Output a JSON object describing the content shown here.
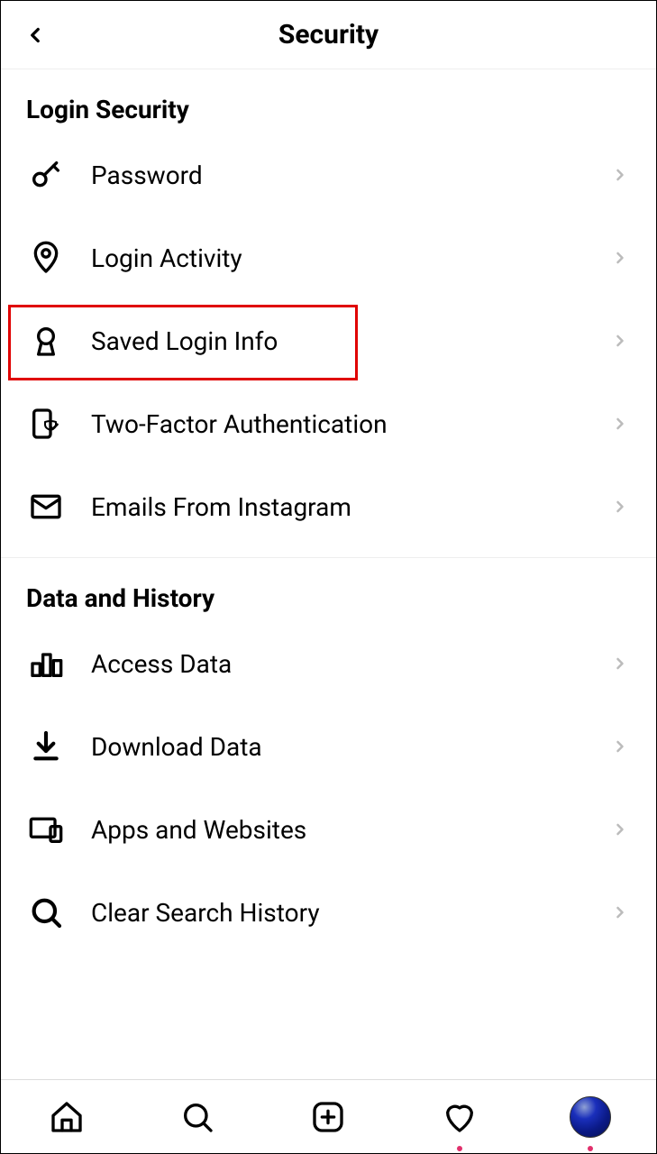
{
  "header": {
    "title": "Security"
  },
  "sections": {
    "login_security": {
      "title": "Login Security",
      "items": [
        {
          "label": "Password"
        },
        {
          "label": "Login Activity"
        },
        {
          "label": "Saved Login Info"
        },
        {
          "label": "Two-Factor Authentication"
        },
        {
          "label": "Emails From Instagram"
        }
      ]
    },
    "data_history": {
      "title": "Data and History",
      "items": [
        {
          "label": "Access Data"
        },
        {
          "label": "Download Data"
        },
        {
          "label": "Apps and Websites"
        },
        {
          "label": "Clear Search History"
        }
      ]
    }
  },
  "highlighted_item_index": 2,
  "tabbar": {
    "activity_dot": true,
    "profile_dot": true
  }
}
